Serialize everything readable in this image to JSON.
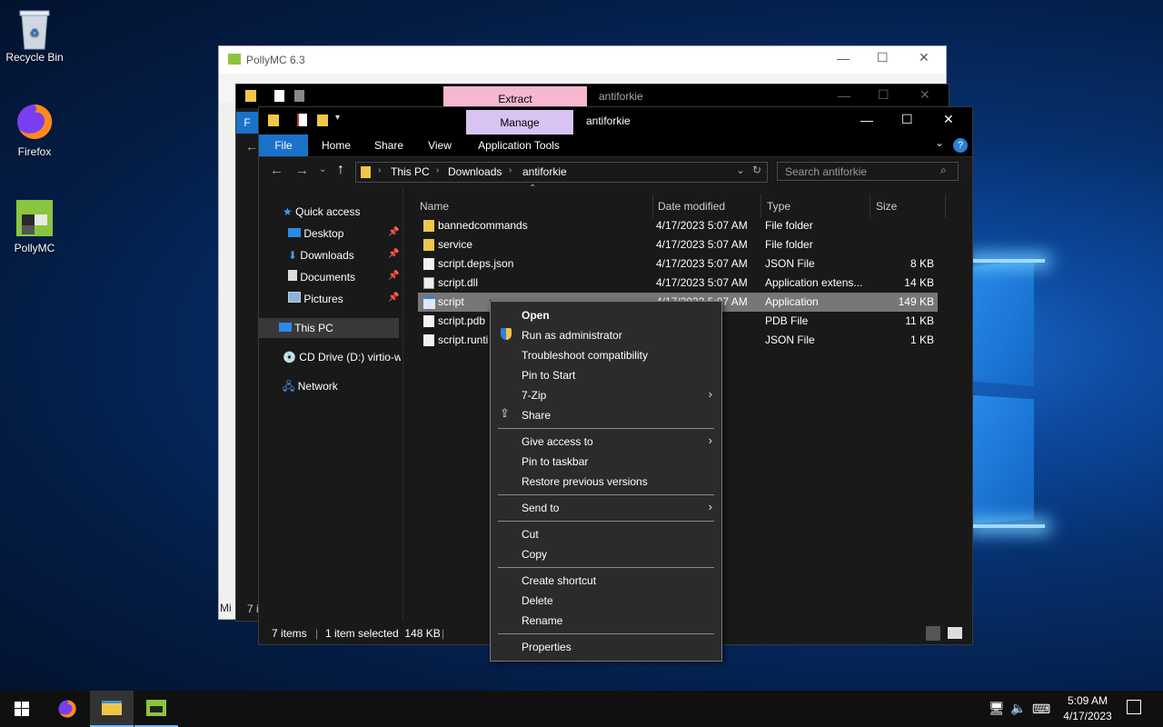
{
  "desktop": {
    "recycle_bin": "Recycle Bin",
    "firefox": "Firefox",
    "pollymc": "PollyMC"
  },
  "pollymc_window": {
    "title": "PollyMC 6.3"
  },
  "back_explorer": {
    "context_tab": "Extract",
    "title": "antiforkie",
    "side_letter": "F",
    "bottom_text": "Mi",
    "bottom_count": "7 i"
  },
  "explorer": {
    "context_tab": "Manage",
    "title": "antiforkie",
    "ribbon": {
      "file": "File",
      "home": "Home",
      "share": "Share",
      "view": "View",
      "app_tools": "Application Tools"
    },
    "breadcrumb": {
      "this_pc": "This PC",
      "downloads": "Downloads",
      "folder": "antiforkie"
    },
    "search_placeholder": "Search antiforkie",
    "nav": {
      "quick_access": "Quick access",
      "desktop": "Desktop",
      "downloads": "Downloads",
      "documents": "Documents",
      "pictures": "Pictures",
      "this_pc": "This PC",
      "cd_drive": "CD Drive (D:) virtio-w",
      "network": "Network"
    },
    "columns": {
      "name": "Name",
      "date": "Date modified",
      "type": "Type",
      "size": "Size"
    },
    "files": [
      {
        "name": "bannedcommands",
        "date": "4/17/2023 5:07 AM",
        "type": "File folder",
        "size": "",
        "icon": "folder"
      },
      {
        "name": "service",
        "date": "4/17/2023 5:07 AM",
        "type": "File folder",
        "size": "",
        "icon": "folder"
      },
      {
        "name": "script.deps.json",
        "date": "4/17/2023 5:07 AM",
        "type": "JSON File",
        "size": "8 KB",
        "icon": "file"
      },
      {
        "name": "script.dll",
        "date": "4/17/2023 5:07 AM",
        "type": "Application extens...",
        "size": "14 KB",
        "icon": "dll"
      },
      {
        "name": "script",
        "date": "4/17/2023 5:07 AM",
        "type": "Application",
        "size": "149 KB",
        "icon": "app"
      },
      {
        "name": "script.pdb",
        "date": "7 AM",
        "type": "PDB File",
        "size": "11 KB",
        "icon": "file"
      },
      {
        "name": "script.runti",
        "date": "7 AM",
        "type": "JSON File",
        "size": "1 KB",
        "icon": "file"
      }
    ],
    "status": {
      "items": "7 items",
      "selected": "1 item selected  148 KB"
    }
  },
  "context_menu": {
    "open": "Open",
    "run_admin": "Run as administrator",
    "troubleshoot": "Troubleshoot compatibility",
    "pin_start": "Pin to Start",
    "zip": "7-Zip",
    "share": "Share",
    "give_access": "Give access to",
    "pin_taskbar": "Pin to taskbar",
    "restore": "Restore previous versions",
    "send_to": "Send to",
    "cut": "Cut",
    "copy": "Copy",
    "create_shortcut": "Create shortcut",
    "delete": "Delete",
    "rename": "Rename",
    "properties": "Properties"
  },
  "taskbar": {
    "time": "5:09 AM",
    "date": "4/17/2023"
  },
  "colors": {
    "manage_tab": "#d9c3f3",
    "extract_tab": "#f6b8d0",
    "file_tab": "#1a72c9",
    "folder": "#f0c649",
    "selection": "#777777"
  }
}
